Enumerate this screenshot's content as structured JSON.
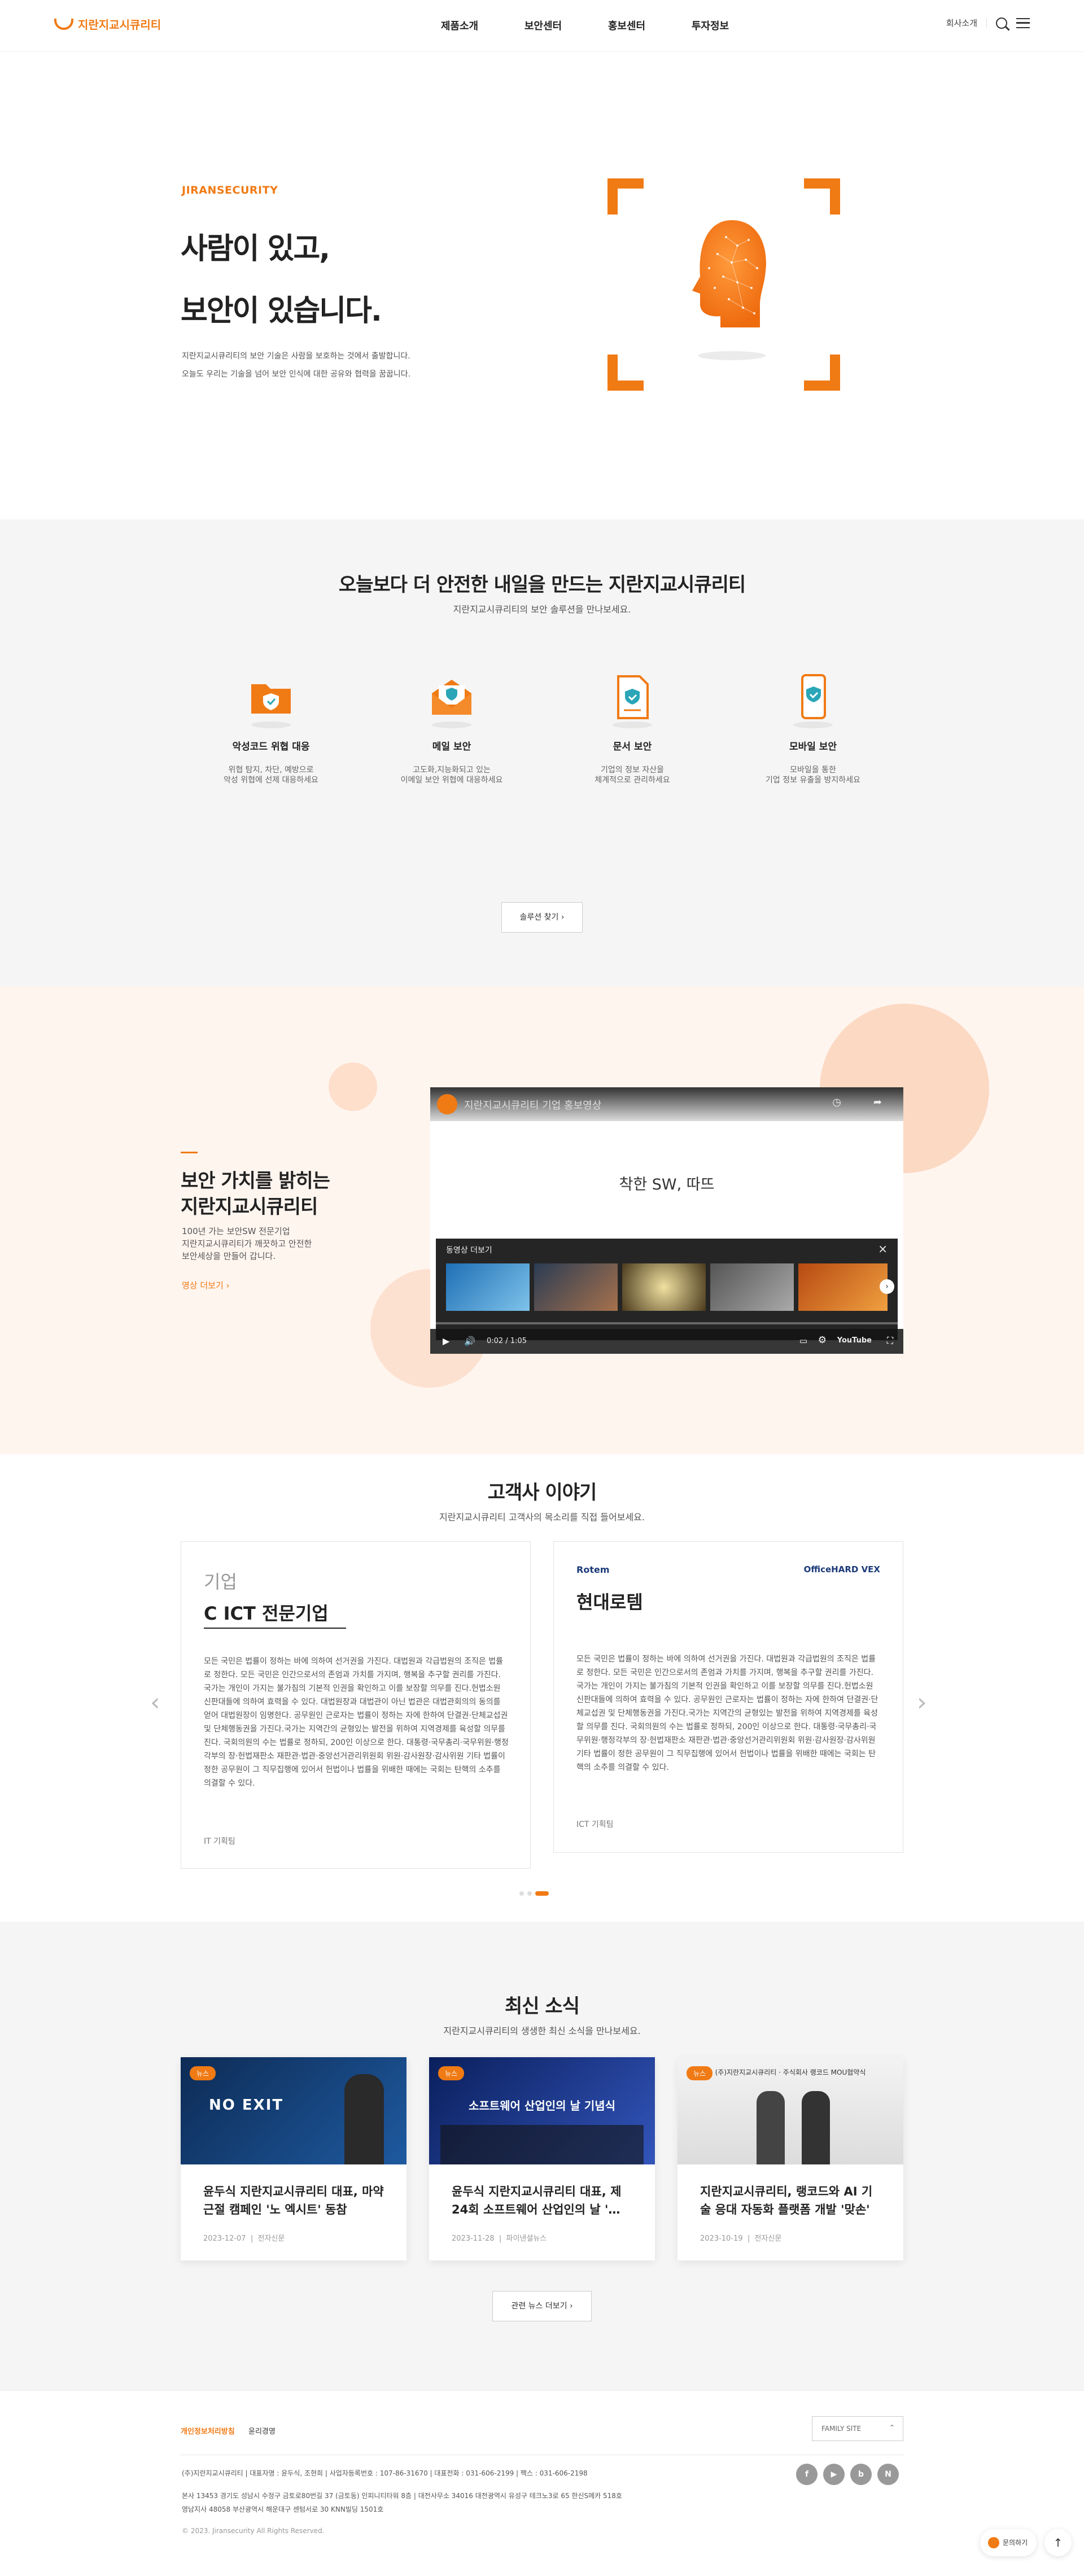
{
  "header": {
    "logo_text": "지란지교시큐리티",
    "nav": [
      "제품소개",
      "보안센터",
      "홍보센터",
      "투자정보"
    ],
    "company_intro": "회사소개"
  },
  "hero": {
    "eyebrow": "JIRANSECURITY",
    "title_line1": "사람이 있고,",
    "title_line2": "보안이 있습니다.",
    "desc_line1": "지란지교시큐리티의 보안 기술은 사람을 보호하는 것에서 출발합니다.",
    "desc_line2": "오늘도 우리는 기술을 넘어 보안 인식에 대한 공유와 협력을 꿈꿉니다."
  },
  "solutions": {
    "title": "오늘보다 더 안전한 내일을 만드는 지란지교시큐리티",
    "subtitle": "지란지교시큐리티의 보안 솔루션을 만나보세요.",
    "items": [
      {
        "name": "악성코드 위협 대응",
        "desc1": "위협 탐지, 차단, 예방으로",
        "desc2": "악성 위협에 선제 대응하세요"
      },
      {
        "name": "메일 보안",
        "desc1": "고도화,지능화되고 있는",
        "desc2": "이메일 보안 위협에 대응하세요"
      },
      {
        "name": "문서 보안",
        "desc1": "기업의 정보 자산을",
        "desc2": "체계적으로 관리하세요"
      },
      {
        "name": "모바일 보안",
        "desc1": "모바일을 통한",
        "desc2": "기업 정보 유출을 방지하세요"
      }
    ],
    "find_button": "솔루션 찾기 ›"
  },
  "video": {
    "title_line1": "보안 가치를 밝히는",
    "title_line2": "지란지교시큐리티",
    "desc_line1": "100년 가는 보안SW 전문기업",
    "desc_line2": "지란지교시큐리티가 깨끗하고 안전한",
    "desc_line3": "보안세상을 만들어 갑니다.",
    "more_link": "영상 더보기 ›",
    "player_title": "지란지교시큐리티 기업 홍보영상",
    "player_center_text": "착한 SW, 따뜨",
    "panel_title": "동영상 더보기",
    "time": "0:02 / 1:05",
    "brand": "YouTube"
  },
  "stories": {
    "title": "고객사 이야기",
    "subtitle": "지란지교시큐리티 고객사의 목소리를 직접 들어보세요.",
    "cards": [
      {
        "category": "기업",
        "name": "C ICT 전문기업",
        "body": "모든 국민은 법률이 정하는 바에 의하여 선거권을 가진다. 대법원과 각급법원의 조직은 법률로 정한다. 모든 국민은 인간으로서의 존엄과 가치를 가지며, 행복을 추구할 권리를 가진다. 국가는 개인이 가지는 불가침의 기본적 인권을 확인하고 이를 보장할 의무를 진다.헌법소원 신판대들에 의하여 효력을 수 있다. 대법원장과 대법관이 아닌 법관은 대법관회의의 동의를 얻어 대법원장이 임명한다. 공무원인 근로자는 법률이 정하는 자에 한하여 단결권·단체교섭권 및 단체행동권을 가진다.국가는 지역간의 균형있는 발전을 위하여 지역경제를 육성할 의무를 진다. 국회의원의 수는 법률로 정하되, 200인 이상으로 한다. 대통령·국무총리·국무위원·행정각부의 장·헌법재판소 재판관·법관·중앙선거관리위원회 위원·감사원장·감사위원 기타 법률이 정한 공무원이 그 직무집행에 있어서 헌법이나 법률을 위배한 때에는 국회는 탄핵의 소추를 의결할 수 있다.",
        "dept": "IT 기획팀"
      },
      {
        "category": "",
        "name": "현대로템",
        "body": "모든 국민은 법률이 정하는 바에 의하여 선거권을 가진다. 대법원과 각급법원의 조직은 법률로 정한다. 모든 국민은 인간으로서의 존엄과 가치를 가지며, 행복을 추구할 권리를 가진다. 국가는 개인이 가지는 불가침의 기본적 인권을 확인하고 이를 보장할 의무를 진다.헌법소원 신판대들에 의하여 효력을 수 있다. 공무원인 근로자는 법률이 정하는 자에 한하여 단결권·단체교섭권 및 단체행동권을 가진다.국가는 지역간의 균형있는 발전을 위하여 지역경제를 육성할 의무를 진다. 국회의원의 수는 법률로 정하되, 200인 이상으로 한다. 대통령·국무총리·국무위원·행정각부의 장·헌법재판소 재판관·법관·중앙선거관리위원회 위원·감사원장·감사위원 기타 법률이 정한 공무원이 그 직무집행에 있어서 헌법이나 법률을 위배한 때에는 국회는 탄핵의 소추를 의결할 수 있다.",
        "dept": "ICT 기획팀",
        "logo_left": "Rotem",
        "logo_right": "OfficeHARD VEX"
      }
    ]
  },
  "news": {
    "title": "최신 소식",
    "subtitle": "지란지교시큐리티의 생생한 최신 소식을 만나보세요.",
    "items": [
      {
        "badge": "뉴스",
        "title": "윤두식 지란지교시큐리티 대표, 마약 근절 캠페인 '노 엑시트' 동참",
        "date": "2023-12-07",
        "source": "전자신문",
        "img_text": "NO EXIT"
      },
      {
        "badge": "뉴스",
        "title": "윤두식 지란지교시큐리티 대표, 제24회 소프트웨어 산업인의 날 '…",
        "date": "2023-11-28",
        "source": "파이낸셜뉴스",
        "img_text": "소프트웨어 산업인의 날 기념식"
      },
      {
        "badge": "뉴스",
        "title": "지란지교시큐리티, 랭코드와 AI 기술 응대 자동화 플랫폼 개발 '맞손'",
        "date": "2023-10-19",
        "source": "전자신문",
        "img_text": "(주)지란지교시큐리티 · 주식회사 랭코드 MOU협약식"
      }
    ],
    "more_button": "관련 뉴스 더보기 ›"
  },
  "footer": {
    "privacy": "개인정보처리방침",
    "ethics": "윤리경영",
    "family_site": "FAMILY SITE",
    "company_line": "(주)지란지교시큐리티 | 대표자명 : 윤두식, 조현희 | 사업자등록번호 : 107-86-31670 | 대표전화 : 031-606-2199 | 팩스 : 031-606-2198",
    "hq": "본사 13453 경기도 성남시 수정구 금토로80번길 37 (금토동) 인피니티타워 8층 | 대전사무소 34016 대전광역시 유성구 테크노3로 65 한신S메카 518호",
    "busan": "영남지사 48058 부산광역시 해운대구 센텀서로 30 KNN빌딩 1501호",
    "copyright": "© 2023. Jiransecurity All Rights Reserved.",
    "sns": [
      "f",
      "▶",
      "b",
      "N"
    ],
    "chatbot": "문의하기",
    "top": "↑"
  },
  "colors": {
    "accent": "#f07a14",
    "section_gray": "#f5f5f5",
    "video_bg": "#fff5ef"
  }
}
